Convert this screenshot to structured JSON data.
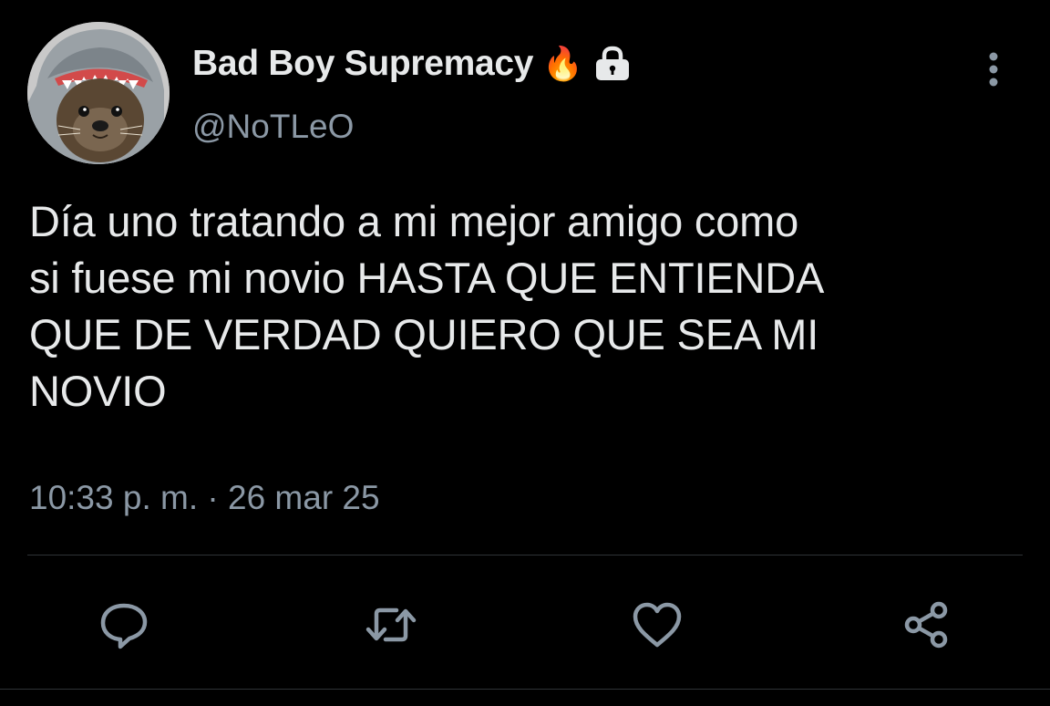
{
  "author": {
    "display_name": "Bad Boy Supremacy",
    "name_emoji": "🔥",
    "handle": "@NoTLeO",
    "protected_icon": "lock-icon",
    "avatar_description_icon": "otter-shark-hood-avatar"
  },
  "tweet": {
    "text": "Día uno tratando a mi mejor amigo como\nsi fuese mi novio HASTA QUE ENTIENDA\nQUE DE VERDAD QUIERO QUE SEA MI\nNOVIO",
    "time": "10:33 p. m.",
    "separator": "·",
    "date": "26 mar 25"
  },
  "actions": [
    {
      "name": "reply",
      "icon": "reply-icon"
    },
    {
      "name": "retweet",
      "icon": "retweet-icon"
    },
    {
      "name": "like",
      "icon": "heart-icon"
    },
    {
      "name": "share",
      "icon": "share-icon"
    }
  ],
  "colors": {
    "background": "#000000",
    "primary_text": "#e7e9ea",
    "secondary_text": "#8b98a5",
    "divider": "#2f3336",
    "icon": "#8b98a5"
  }
}
